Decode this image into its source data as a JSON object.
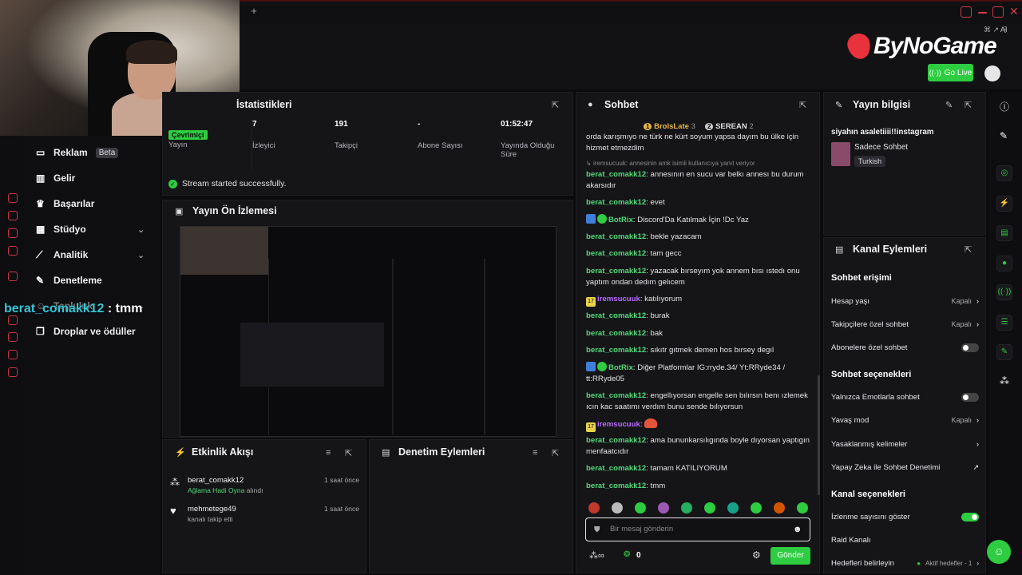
{
  "browser": {
    "new_tab": "+",
    "ai_label": "AI"
  },
  "brand": {
    "name": "ByNoGame",
    "go_live": "Go Live"
  },
  "overlay": {
    "username": "berat_comakk12",
    "message": " : tmm"
  },
  "menu": {
    "items": [
      {
        "label": "Reklam",
        "badge": "Beta"
      },
      {
        "label": "Gelir"
      },
      {
        "label": "Başarılar"
      },
      {
        "label": "Stüdyo"
      },
      {
        "label": "Analitik"
      },
      {
        "label": "Denetleme"
      },
      {
        "label": "Topluluk"
      },
      {
        "label": "Droplar ve ödüller"
      }
    ]
  },
  "stats": {
    "title": "İstatistikleri",
    "online_badge": "Çevrimiçi",
    "cells": [
      {
        "value": "",
        "label": "Yayın"
      },
      {
        "value": "7",
        "label": "İzleyici"
      },
      {
        "value": "191",
        "label": "Takipçi"
      },
      {
        "value": "-",
        "label": "Abone Sayısı"
      },
      {
        "value": "01:52:47",
        "label": "Yayında Olduğu Süre"
      }
    ],
    "status": "Stream started successfully."
  },
  "preview": {
    "title": "Yayın Ön İzlemesi"
  },
  "activity": {
    "title": "Etkinlik Akışı",
    "items": [
      {
        "user": "berat_comakk12",
        "detail_highlight": "Ağlama Hadi Oyna",
        "detail": " alındı",
        "time": "1 saat önce"
      },
      {
        "user": "mehmetege49",
        "detail_highlight": "",
        "detail": "kanalı takip etti",
        "time": "1 saat önce"
      }
    ]
  },
  "moderation": {
    "title": "Denetim Eylemleri"
  },
  "chat": {
    "title": "Sohbet",
    "top_users": [
      {
        "name": "BrolsLate",
        "count": "3"
      },
      {
        "name": "SEREAN",
        "count": "2"
      }
    ],
    "first_line": "orda karışmıyo ne türk ne kürt soyum yapsa dayım bu ülke için hizmet etmezdim",
    "reply_hint": "iremsucuuk: annesinin amk isimli kullanıcıya yanıt veriyor",
    "messages": [
      {
        "user": "berat_comakk12",
        "text": "annesının en sucu var belkı annesı bu durum akarsıdır"
      },
      {
        "user": "berat_comakk12",
        "text": "evet"
      },
      {
        "user": "BotRix",
        "text": "Discord'Da Katılmak İçin !Dc Yaz"
      },
      {
        "user": "berat_comakk12",
        "text": "bekle yazacam"
      },
      {
        "user": "berat_comakk12",
        "text": "tam gecc"
      },
      {
        "user": "berat_comakk12",
        "text": "yazacak bırseyım yok annem bısı ıstedı onu yaptım ondan dedım gelıcem"
      },
      {
        "user": "iremsucuuk",
        "text": "katılıyorum"
      },
      {
        "user": "berat_comakk12",
        "text": "burak"
      },
      {
        "user": "berat_comakk12",
        "text": "bak"
      },
      {
        "user": "berat_comakk12",
        "text": "sıkıtr gıtmek demen hos bırsey degıl"
      },
      {
        "user": "BotRix",
        "text": "Diğer Platformlar IG:rryde.34/ Yt:RRyde34 / tt:RRyde05"
      },
      {
        "user": "berat_comakk12",
        "text": "engellıyorsan engelle sen bılırsın benı ızlemek ıcın kac saatımı verdım bunu sende bılıyorsun"
      },
      {
        "user": "iremsucuuk",
        "text": ""
      },
      {
        "user": "berat_comakk12",
        "text": "ama bununkarsılıgında boyle dıyorsan yaptıgın menfaatcıdır"
      },
      {
        "user": "berat_comakk12",
        "text": "tamam KATILIYORUM"
      },
      {
        "user": "berat_comakk12",
        "text": "tmm"
      }
    ],
    "input_placeholder": "Bir mesaj gönderin",
    "viewers": "0",
    "send": "Gönder"
  },
  "stream_info": {
    "title": "Yayın bilgisi",
    "stream_title": "siyahın asaletiiii!!instagram",
    "category": "Sadece Sohbet",
    "language": "Turkish"
  },
  "channel_actions": {
    "title": "Kanal Eylemleri",
    "chat_access": "Sohbet erişimi",
    "account_age": {
      "label": "Hesap yaşı",
      "value": "Kapalı"
    },
    "followers_only": {
      "label": "Takipçilere özel sohbet",
      "value": "Kapalı"
    },
    "subscribers_only": {
      "label": "Abonelere özel sohbet"
    },
    "chat_options": "Sohbet seçenekleri",
    "emotes_only": {
      "label": "Yalnızca Emotlarla sohbet"
    },
    "slow_mode": {
      "label": "Yavaş mod",
      "value": "Kapalı"
    },
    "banned_words": {
      "label": "Yasaklanmış kelimeler"
    },
    "ai_moderation": {
      "label": "Yapay Zeka ile Sohbet Denetimi"
    },
    "channel_options": "Kanal seçenekleri",
    "show_viewers": {
      "label": "İzlenme sayısını göster"
    },
    "raid": {
      "label": "Raid Kanalı"
    },
    "goals": {
      "label": "Hedefleri belirleyin",
      "value": "Aktif hedefler - 1"
    }
  },
  "colors": {
    "accent": "#2ecc40",
    "brand_red": "#e8323c",
    "user_green": "#52d97a",
    "user_purple": "#b86bff"
  }
}
